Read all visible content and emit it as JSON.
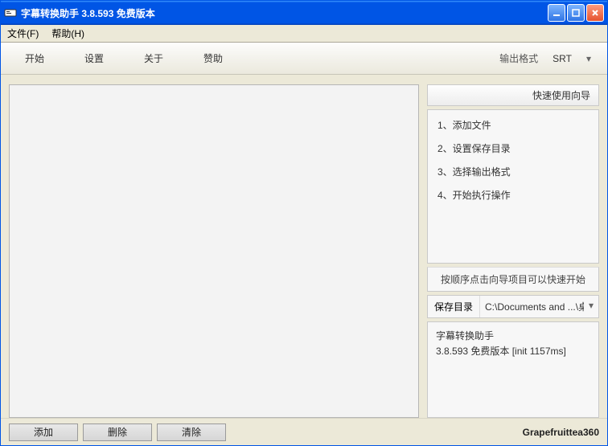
{
  "window": {
    "title": "字幕转换助手 3.8.593 免费版本"
  },
  "menubar": {
    "file": "文件(F)",
    "help": "帮助(H)"
  },
  "toolbar": {
    "tabs": {
      "start": "开始",
      "settings": "设置",
      "about": "关于",
      "donate": "赞助"
    },
    "format_label": "输出格式",
    "format_value": "SRT"
  },
  "wizard": {
    "header": "快速使用向导",
    "items": [
      "1、添加文件",
      "2、设置保存目录",
      "3、选择输出格式",
      "4、开始执行操作"
    ],
    "hint": "按顺序点击向导项目可以快速开始"
  },
  "savepath": {
    "label": "保存目录",
    "value": "C:\\Documents and ...\\桌面\\"
  },
  "info": {
    "name": "字幕转换助手",
    "version": "3.8.593 免费版本  [init 1157ms]"
  },
  "footer": {
    "add": "添加",
    "delete": "删除",
    "clear": "清除",
    "brand": "Grapefruittea360"
  }
}
